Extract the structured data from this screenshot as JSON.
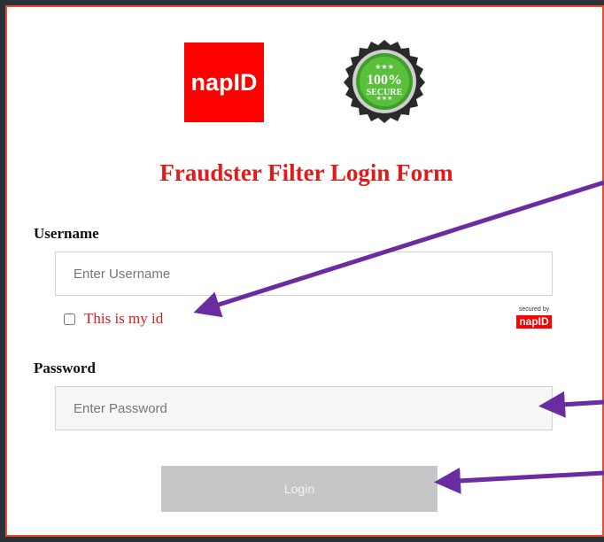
{
  "brand": {
    "logo_text": "napID",
    "logo_color": "#ff0000",
    "seal_text_top": "100%",
    "seal_text_bottom": "SECURE"
  },
  "form": {
    "title": "Fraudster Filter Login Form",
    "username_label": "Username",
    "username_placeholder": "Enter Username",
    "username_value": "",
    "remember_label": "This is my id",
    "remember_checked": false,
    "secured_by_text": "secured by",
    "secured_by_logo": "napID",
    "password_label": "Password",
    "password_placeholder": "Enter Password",
    "password_value": "",
    "login_label": "Login"
  },
  "colors": {
    "frame_border": "#e8502a",
    "title_red": "#e21a1a",
    "arrow_purple": "#6a2ca0",
    "button_gray": "#c6c6c6",
    "background_dark": "#2b3138"
  }
}
